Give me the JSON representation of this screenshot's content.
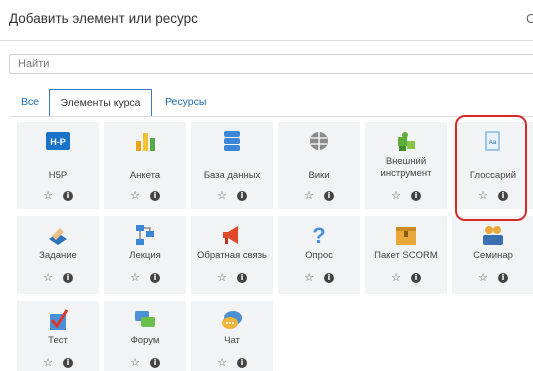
{
  "dialog": {
    "title": "Добавить элемент или ресурс",
    "close_glyph": "С"
  },
  "search": {
    "placeholder": "Найти",
    "value": ""
  },
  "tabs": {
    "all": "Все",
    "course_elements": "Элементы курса",
    "resources": "Ресурсы"
  },
  "actions": {
    "star_glyph": "☆",
    "info_glyph": "i"
  },
  "modules": [
    {
      "label": "H5P",
      "icon": "h5p-icon"
    },
    {
      "label": "Анкета",
      "icon": "bar-chart-icon"
    },
    {
      "label": "База данных",
      "icon": "database-icon"
    },
    {
      "label": "Вики",
      "icon": "wiki-icon"
    },
    {
      "label": "Внешний инструмент",
      "icon": "puzzle-icon"
    },
    {
      "label": "Глоссарий",
      "icon": "glossary-icon",
      "highlighted": true
    },
    {
      "label": "Задание",
      "icon": "assignment-icon"
    },
    {
      "label": "Лекция",
      "icon": "lesson-icon"
    },
    {
      "label": "Обратная связь",
      "icon": "megaphone-icon"
    },
    {
      "label": "Опрос",
      "icon": "question-icon"
    },
    {
      "label": "Пакет SCORM",
      "icon": "scorm-package-icon"
    },
    {
      "label": "Семинар",
      "icon": "workshop-icon"
    },
    {
      "label": "Тест",
      "icon": "quiz-checkmark-icon"
    },
    {
      "label": "Форум",
      "icon": "forum-icon"
    },
    {
      "label": "Чат",
      "icon": "chat-icon"
    }
  ],
  "colors": {
    "accent_blue": "#1a6fb5",
    "highlight_red": "#d42a2a",
    "tile_bg": "#f2f3f5"
  }
}
